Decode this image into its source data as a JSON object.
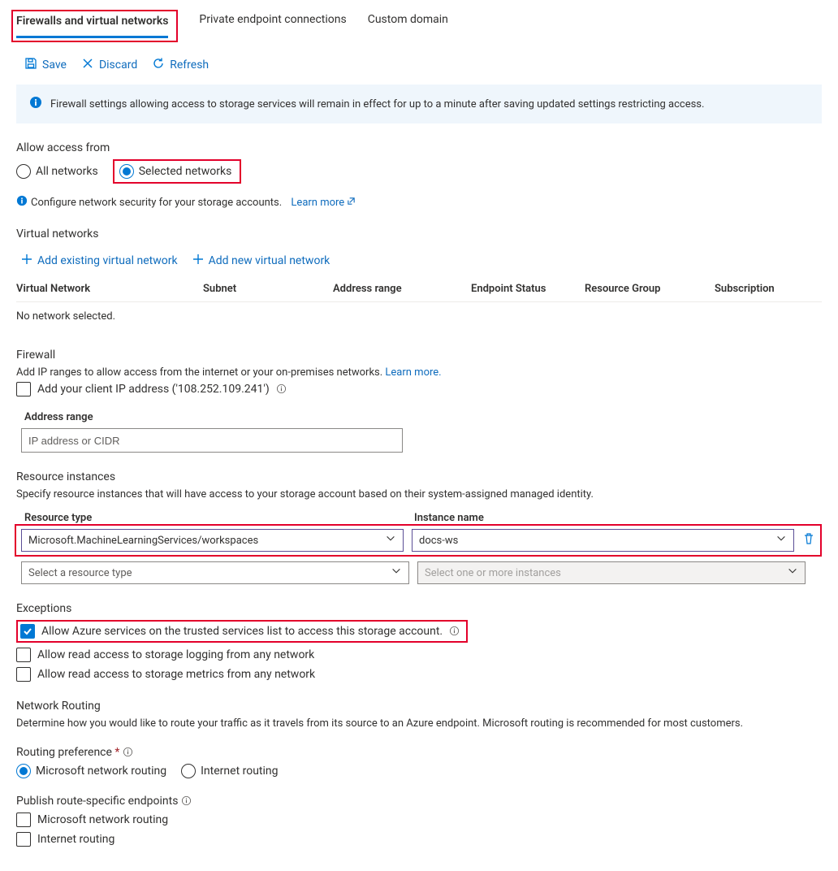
{
  "tabs": {
    "firewalls": "Firewalls and virtual networks",
    "private_ep": "Private endpoint connections",
    "custom_domain": "Custom domain"
  },
  "toolbar": {
    "save": "Save",
    "discard": "Discard",
    "refresh": "Refresh"
  },
  "banner": "Firewall settings allowing access to storage services will remain in effect for up to a minute after saving updated settings restricting access.",
  "access": {
    "label": "Allow access from",
    "all": "All networks",
    "selected": "Selected networks",
    "config_text": "Configure network security for your storage accounts.",
    "learn_more": "Learn more"
  },
  "vnets": {
    "title": "Virtual networks",
    "add_existing": "Add existing virtual network",
    "add_new": "Add new virtual network",
    "cols": {
      "vnet": "Virtual Network",
      "subnet": "Subnet",
      "range": "Address range",
      "ep": "Endpoint Status",
      "rg": "Resource Group",
      "sub": "Subscription"
    },
    "empty": "No network selected."
  },
  "firewall": {
    "title": "Firewall",
    "desc": "Add IP ranges to allow access from the internet or your on-premises networks.",
    "learn_more": "Learn more.",
    "add_client_ip": "Add your client IP address ('108.252.109.241')",
    "range_label": "Address range",
    "range_placeholder": "IP address or CIDR"
  },
  "resource_instances": {
    "title": "Resource instances",
    "desc": "Specify resource instances that will have access to your storage account based on their system-assigned managed identity.",
    "col_type": "Resource type",
    "col_name": "Instance name",
    "row_type": "Microsoft.MachineLearningServices/workspaces",
    "row_name": "docs-ws",
    "ph_type": "Select a resource type",
    "ph_name": "Select one or more instances"
  },
  "exceptions": {
    "title": "Exceptions",
    "opt1": "Allow Azure services on the trusted services list to access this storage account.",
    "opt2": "Allow read access to storage logging from any network",
    "opt3": "Allow read access to storage metrics from any network"
  },
  "routing": {
    "title": "Network Routing",
    "desc": "Determine how you would like to route your traffic as it travels from its source to an Azure endpoint. Microsoft routing is recommended for most customers.",
    "pref_label": "Routing preference",
    "ms": "Microsoft network routing",
    "internet": "Internet routing",
    "publish_label": "Publish route-specific endpoints",
    "pub_ms": "Microsoft network routing",
    "pub_internet": "Internet routing"
  }
}
